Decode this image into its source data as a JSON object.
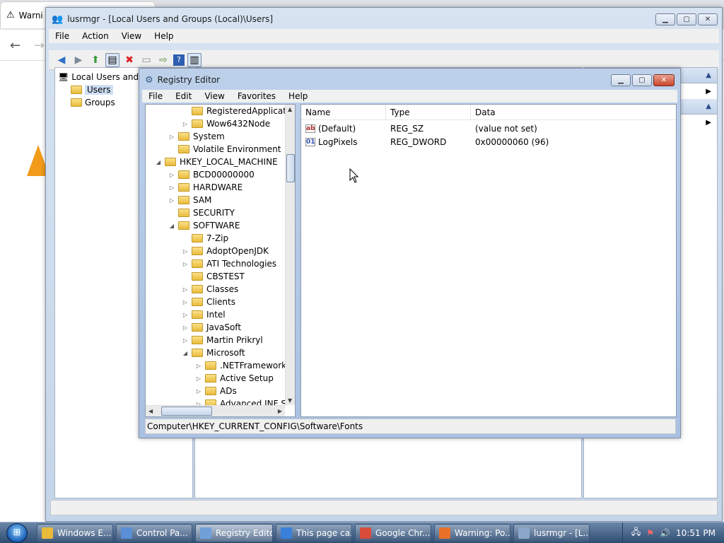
{
  "browser": {
    "tab_title": "Warni"
  },
  "lusrmgr": {
    "title": "lusrmgr - [Local Users and Groups (Local)\\Users]",
    "menu": [
      "File",
      "Action",
      "View",
      "Help"
    ],
    "tree": {
      "root": "Local Users and G",
      "items": [
        "Users",
        "Groups"
      ]
    }
  },
  "regedit": {
    "title": "Registry Editor",
    "menu": [
      "File",
      "Edit",
      "View",
      "Favorites",
      "Help"
    ],
    "tree": [
      {
        "label": "RegisteredApplicatio",
        "depth": 2,
        "expander": "none"
      },
      {
        "label": "Wow6432Node",
        "depth": 2,
        "expander": "collapsed"
      },
      {
        "label": "System",
        "depth": 1,
        "expander": "collapsed"
      },
      {
        "label": "Volatile Environment",
        "depth": 1,
        "expander": "none"
      },
      {
        "label": "HKEY_LOCAL_MACHINE",
        "depth": 0,
        "expander": "expanded"
      },
      {
        "label": "BCD00000000",
        "depth": 1,
        "expander": "collapsed"
      },
      {
        "label": "HARDWARE",
        "depth": 1,
        "expander": "collapsed"
      },
      {
        "label": "SAM",
        "depth": 1,
        "expander": "collapsed"
      },
      {
        "label": "SECURITY",
        "depth": 1,
        "expander": "none"
      },
      {
        "label": "SOFTWARE",
        "depth": 1,
        "expander": "expanded"
      },
      {
        "label": "7-Zip",
        "depth": 2,
        "expander": "none"
      },
      {
        "label": "AdoptOpenJDK",
        "depth": 2,
        "expander": "collapsed"
      },
      {
        "label": "ATI Technologies",
        "depth": 2,
        "expander": "collapsed"
      },
      {
        "label": "CBSTEST",
        "depth": 2,
        "expander": "none"
      },
      {
        "label": "Classes",
        "depth": 2,
        "expander": "collapsed"
      },
      {
        "label": "Clients",
        "depth": 2,
        "expander": "collapsed"
      },
      {
        "label": "Intel",
        "depth": 2,
        "expander": "collapsed"
      },
      {
        "label": "JavaSoft",
        "depth": 2,
        "expander": "collapsed"
      },
      {
        "label": "Martin Prikryl",
        "depth": 2,
        "expander": "collapsed"
      },
      {
        "label": "Microsoft",
        "depth": 2,
        "expander": "expanded"
      },
      {
        "label": ".NETFramework",
        "depth": 3,
        "expander": "collapsed"
      },
      {
        "label": "Active Setup",
        "depth": 3,
        "expander": "collapsed"
      },
      {
        "label": "ADs",
        "depth": 3,
        "expander": "collapsed"
      },
      {
        "label": "Advanced INF Set",
        "depth": 3,
        "expander": "collapsed"
      }
    ],
    "columns": {
      "name": "Name",
      "type": "Type",
      "data": "Data"
    },
    "values": [
      {
        "icon": "string-value-icon",
        "name": "(Default)",
        "type": "REG_SZ",
        "data": "(value not set)"
      },
      {
        "icon": "binary-value-icon",
        "name": "LogPixels",
        "type": "REG_DWORD",
        "data": "0x00000060 (96)"
      }
    ],
    "status_path": "Computer\\HKEY_CURRENT_CONFIG\\Software\\Fonts"
  },
  "taskbar": {
    "buttons": [
      {
        "label": "Windows E...",
        "icon": "folder-icon",
        "color": "#e9bb3b"
      },
      {
        "label": "Control Pa...",
        "icon": "control-panel-icon",
        "color": "#5a8fd6"
      },
      {
        "label": "Registry Editor",
        "icon": "regedit-icon",
        "color": "#6fa0d8",
        "active": true
      },
      {
        "label": "This page ca...",
        "icon": "ie-icon",
        "color": "#3a7fd9"
      },
      {
        "label": "Google Chr...",
        "icon": "chrome-icon",
        "color": "#d94b3a"
      },
      {
        "label": "Warning: Po...",
        "icon": "firefox-icon",
        "color": "#e8722a"
      },
      {
        "label": "lusrmgr - [L...",
        "icon": "lusrmgr-icon",
        "color": "#8aa6c8"
      }
    ],
    "clock": "10:51 PM"
  },
  "colors": {
    "warning_orange": "#f29b1b",
    "close_red": "#c7452b",
    "folder_yellow": "#e9bb3b"
  }
}
